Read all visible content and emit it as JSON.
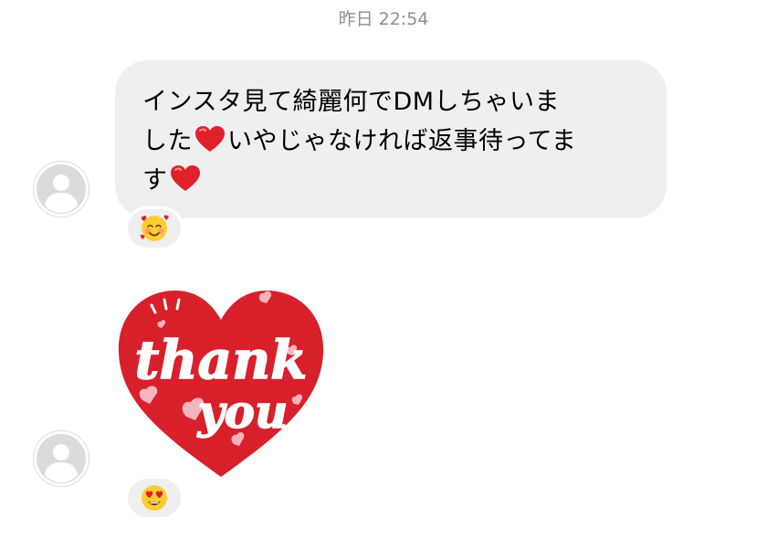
{
  "header": {
    "timestamp": "昨日 22:54"
  },
  "messages": [
    {
      "lines": [
        {
          "text_before": "インスタ見て綺麗何でDMしちゃいま",
          "emoji": "",
          "text_after": ""
        },
        {
          "text_before": "した",
          "emoji": "heart-emoji",
          "text_after": "いやじゃなければ返事待ってま"
        },
        {
          "text_before": "す",
          "emoji": "heart-emoji",
          "text_after": ""
        }
      ],
      "reaction": "smiling-face-with-hearts-emoji"
    },
    {
      "sticker": {
        "word_1": "thank",
        "word_2": "you"
      },
      "reaction": "heart-eyes-emoji"
    }
  ],
  "colors": {
    "bubble": "#efefef",
    "timestamp": "#8e8e8e",
    "sticker_red": "#d8202a",
    "heart_red": "#e0202a"
  }
}
